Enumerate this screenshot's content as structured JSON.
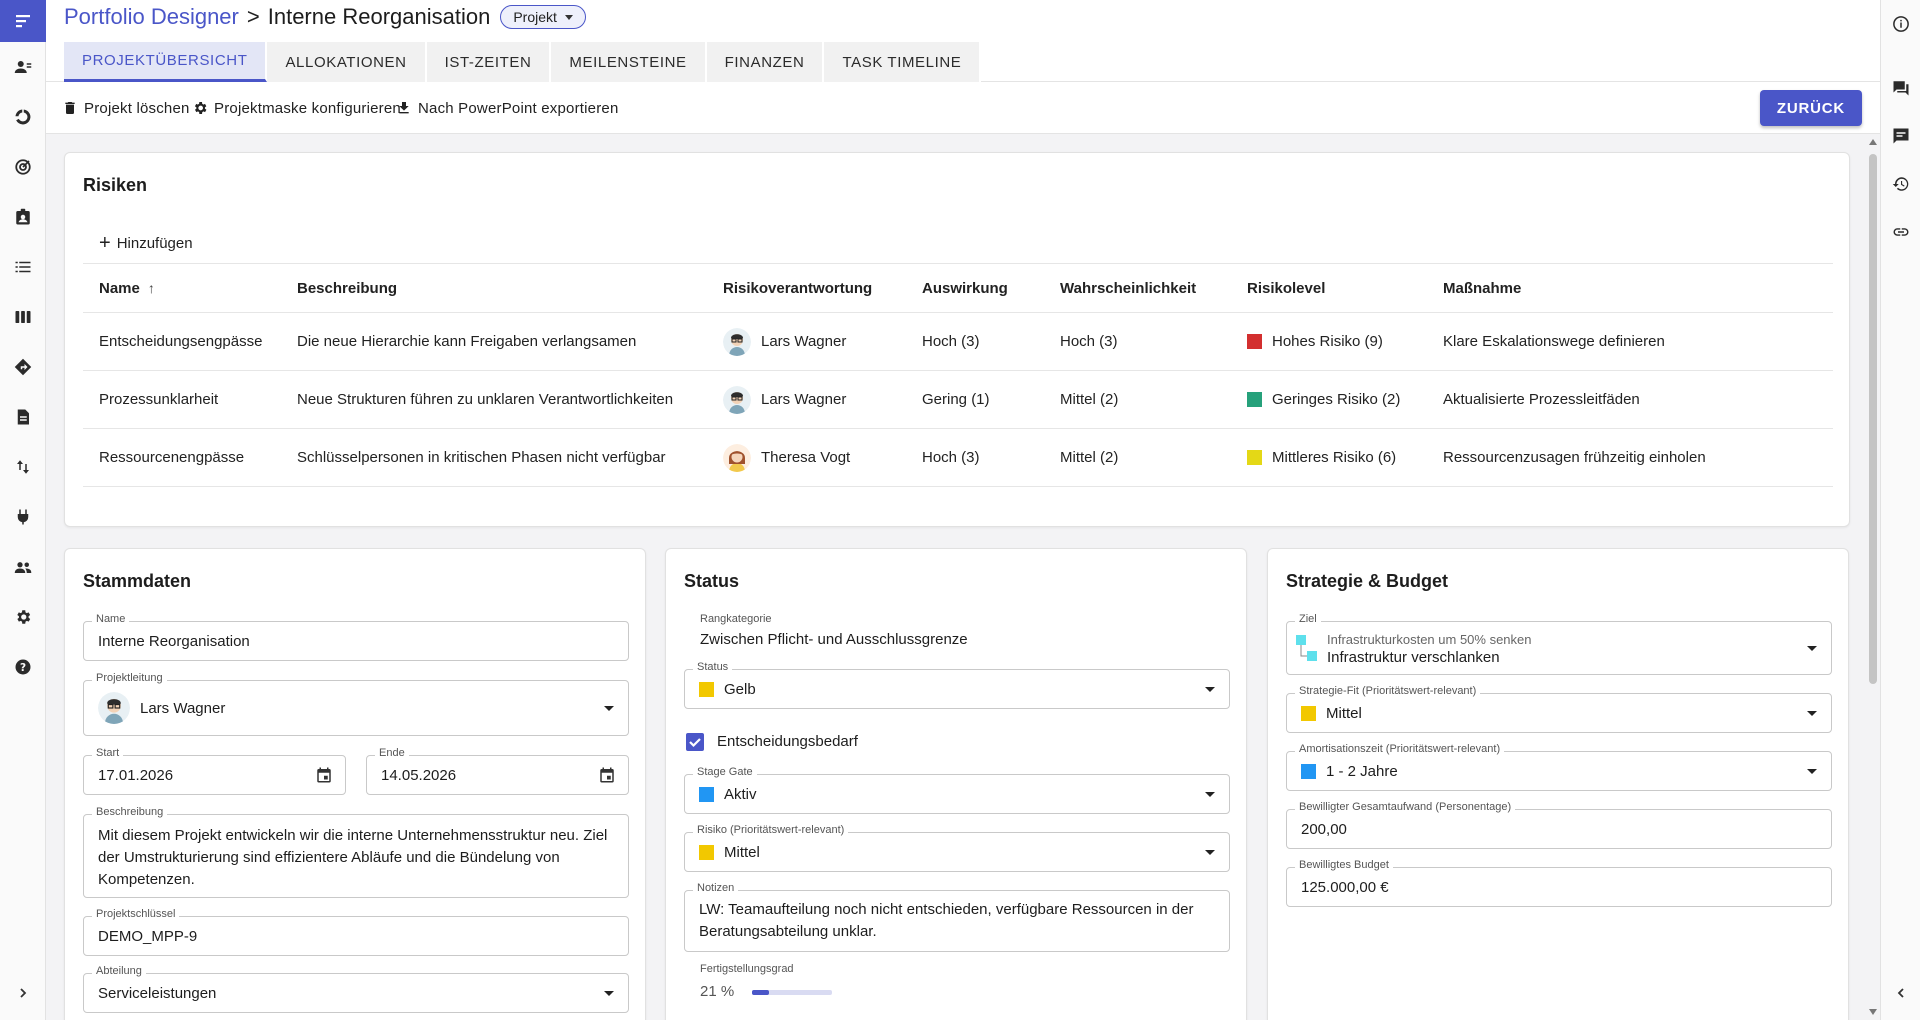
{
  "header": {
    "app_name": "Portfolio Designer",
    "separator": ">",
    "project_name": "Interne Reorganisation",
    "type_chip": "Projekt"
  },
  "tabs": [
    {
      "label": "PROJEKTÜBERSICHT",
      "active": true
    },
    {
      "label": "ALLOKATIONEN"
    },
    {
      "label": "IST-ZEITEN"
    },
    {
      "label": "MEILENSTEINE"
    },
    {
      "label": "FINANZEN"
    },
    {
      "label": "TASK TIMELINE"
    }
  ],
  "toolbar": {
    "delete_label": "Projekt löschen",
    "configure_label": "Projektmaske konfigurieren",
    "export_label": "Nach PowerPoint exportieren",
    "back_label": "ZURÜCK"
  },
  "risks": {
    "title": "Risiken",
    "add_label": "Hinzufügen",
    "columns": [
      "Name",
      "Beschreibung",
      "Risikoverantwortung",
      "Auswirkung",
      "Wahrscheinlichkeit",
      "Risikolevel",
      "Maßnahme"
    ],
    "rows": [
      {
        "name": "Entscheidungsengpässe",
        "description": "Die neue Hierarchie kann Freigaben verlangsamen",
        "owner": "Lars Wagner",
        "impact": "Hoch (3)",
        "probability": "Hoch (3)",
        "level": "Hohes Risiko (9)",
        "level_color": "#d32f2f",
        "measure": "Klare Eskalationswege definieren"
      },
      {
        "name": "Prozessunklarheit",
        "description": "Neue Strukturen führen zu unklaren Verantwortlichkeiten",
        "owner": "Lars Wagner",
        "impact": "Gering (1)",
        "probability": "Mittel (2)",
        "level": "Geringes Risiko (2)",
        "level_color": "#26a17b",
        "measure": "Aktualisierte Prozessleitfäden"
      },
      {
        "name": "Ressourcenengpässe",
        "description": "Schlüsselpersonen in kritischen Phasen nicht verfügbar",
        "owner": "Theresa Vogt",
        "impact": "Hoch (3)",
        "probability": "Mittel (2)",
        "level": "Mittleres Risiko (6)",
        "level_color": "#e4d816",
        "measure": "Ressourcenzusagen frühzeitig einholen"
      }
    ]
  },
  "stammdaten": {
    "title": "Stammdaten",
    "name_label": "Name",
    "name_value": "Interne Reorganisation",
    "lead_label": "Projektleitung",
    "lead_value": "Lars Wagner",
    "start_label": "Start",
    "start_value": "17.01.2026",
    "end_label": "Ende",
    "end_value": "14.05.2026",
    "desc_label": "Beschreibung",
    "desc_value": "Mit diesem Projekt entwickeln wir die interne Unternehmensstruktur neu. Ziel der Umstrukturierung sind effizientere Abläufe und die Bündelung von Kompetenzen.",
    "key_label": "Projektschlüssel",
    "key_value": "DEMO_MPP-9",
    "dept_label": "Abteilung",
    "dept_value": "Serviceleistungen"
  },
  "status": {
    "title": "Status",
    "rank_label": "Rangkategorie",
    "rank_value": "Zwischen Pflicht- und Ausschlussgrenze",
    "status_label": "Status",
    "status_value": "Gelb",
    "status_color": "#f2c800",
    "decision_label": "Entscheidungsbedarf",
    "decision_checked": true,
    "stage_label": "Stage Gate",
    "stage_value": "Aktiv",
    "stage_color": "#2196f3",
    "risk_label": "Risiko (Prioritätswert-relevant)",
    "risk_value": "Mittel",
    "risk_color": "#f2c800",
    "notes_label": "Notizen",
    "notes_value": "LW: Teamaufteilung noch nicht entschieden, verfügbare Ressourcen in der Beratungsabteilung unklar.",
    "progress_label": "Fertigstellungsgrad",
    "progress_text": "21 %",
    "progress_value": 0.21
  },
  "strategie": {
    "title": "Strategie & Budget",
    "goal_label": "Ziel",
    "goal_parent": "Infrastrukturkosten um 50% senken",
    "goal_value": "Infrastruktur verschlanken",
    "fit_label": "Strategie-Fit (Prioritätswert-relevant)",
    "fit_value": "Mittel",
    "fit_color": "#f2c800",
    "amort_label": "Amortisationszeit (Prioritätswert-relevant)",
    "amort_value": "1 - 2 Jahre",
    "amort_color": "#2196f3",
    "effort_label": "Bewilligter Gesamtaufwand (Personentage)",
    "effort_value": "200,00",
    "budget_label": "Bewilligtes Budget",
    "budget_value": "125.000,00 €"
  },
  "icons": {
    "left_nav": [
      "menu-icon",
      "people-icon",
      "donut-chart-icon",
      "target-icon",
      "contact-badge-icon",
      "list-icon",
      "columns-icon",
      "diamond-direction-icon",
      "document-icon",
      "swap-vertical-icon",
      "plug-icon",
      "group-icon",
      "gear-icon",
      "help-icon",
      "chevron-right-icon"
    ],
    "right_rail": [
      "info-icon",
      "chat-icon",
      "feedback-icon",
      "history-icon",
      "link-icon",
      "chevron-left-icon"
    ]
  }
}
